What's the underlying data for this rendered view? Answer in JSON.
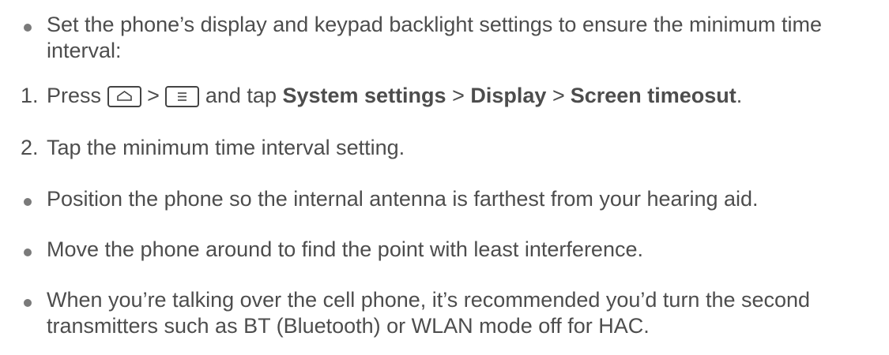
{
  "items": [
    {
      "marker": "bullet",
      "line1": "Set the phone’s display and keypad backlight settings to ensure the minimum time",
      "line2": "interval:"
    },
    {
      "marker": "1.",
      "press": "Press",
      "sep1": ">",
      "and_tap": "and tap",
      "s1": "System settings",
      "sep2": ">",
      "s2": "Display",
      "sep3": ">",
      "s3": "Screen timeosut",
      "end": "."
    },
    {
      "marker": "2.",
      "text": "Tap the minimum time interval setting."
    },
    {
      "marker": "bullet",
      "text": "Position the phone so the internal antenna is farthest from your hearing aid."
    },
    {
      "marker": "bullet",
      "text": "Move the phone around to find the point with least interference."
    },
    {
      "marker": "bullet",
      "line1": "When you’re talking over the cell phone, it’s recommended you’d turn the second",
      "line2": "transmitters such as BT (Bluetooth) or WLAN mode off for HAC."
    }
  ]
}
